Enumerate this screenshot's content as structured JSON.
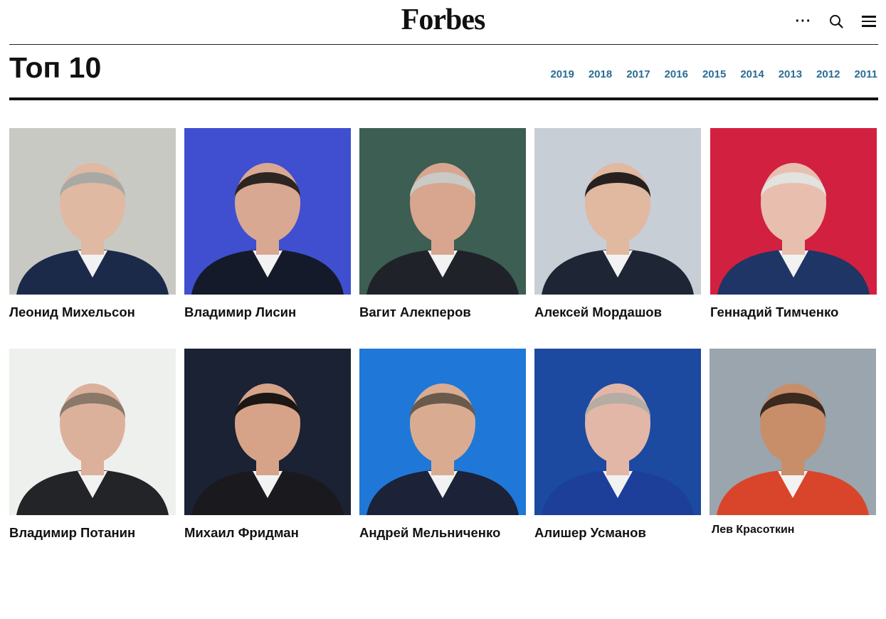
{
  "header": {
    "logo": "Forbes",
    "more_icon": "more-dots-icon",
    "search_icon": "search-icon",
    "menu_icon": "hamburger-menu-icon"
  },
  "page": {
    "title": "Топ 10",
    "years": [
      "2019",
      "2018",
      "2017",
      "2016",
      "2015",
      "2014",
      "2013",
      "2012",
      "2011"
    ]
  },
  "people": [
    {
      "name": "Леонид Михельсон",
      "bg": "#c9c9c4"
    },
    {
      "name": "Владимир Лисин",
      "bg": "#3f4fd0"
    },
    {
      "name": "Вагит Алекперов",
      "bg": "#3d5e52"
    },
    {
      "name": "Алексей Мордашов",
      "bg": "#c7ced6"
    },
    {
      "name": "Геннадий Тимченко",
      "bg": "#d22040"
    },
    {
      "name": "Владимир Потанин",
      "bg": "#eef0ee"
    },
    {
      "name": "Михаил Фридман",
      "bg": "#1a2234"
    },
    {
      "name": "Андрей Мельниченко",
      "bg": "#1f78d8"
    },
    {
      "name": "Алишер Усманов",
      "bg": "#1b4aa0"
    },
    {
      "name": "Лев Красоткин",
      "bg": "#9aa5ad"
    }
  ]
}
